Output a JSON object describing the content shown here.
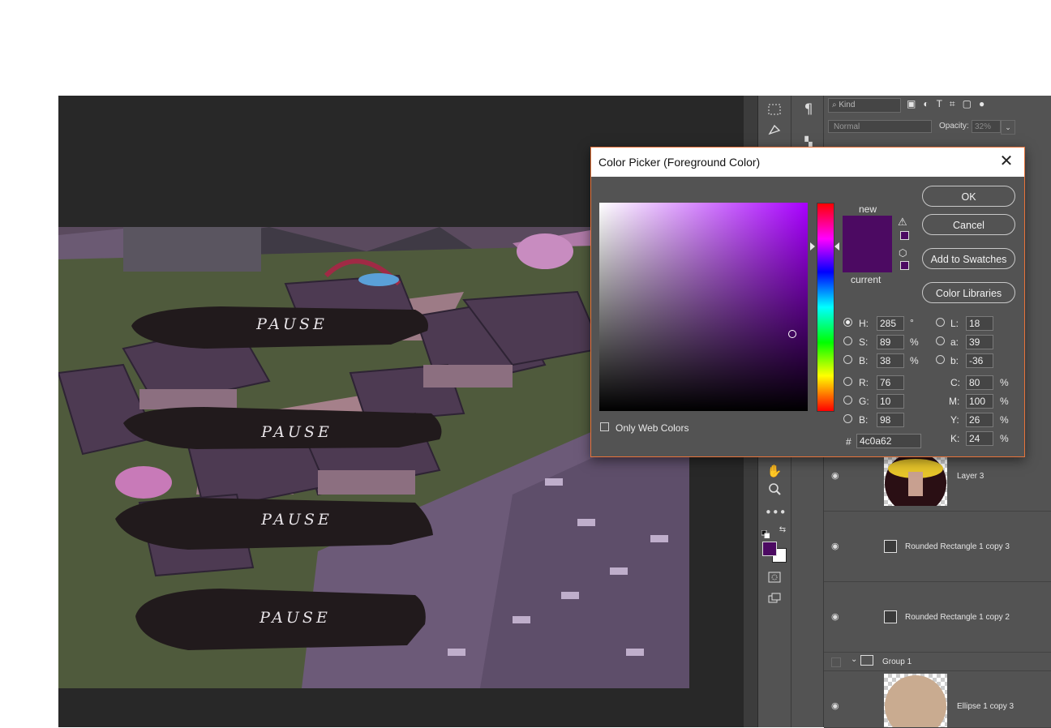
{
  "scene": {
    "pause_buttons": [
      "PAUSE",
      "PAUSE",
      "PAUSE",
      "PAUSE"
    ]
  },
  "layers_panel": {
    "filter_kind": "Kind",
    "blend_mode": "Normal",
    "opacity_label": "Opacity:",
    "opacity_value": "32%",
    "layers": [
      {
        "name": "Layer 3"
      },
      {
        "name": "Rounded Rectangle 1 copy 3"
      },
      {
        "name": "Rounded Rectangle 1 copy 2"
      },
      {
        "name": "Group 1"
      },
      {
        "name": "Ellipse 1 copy 3"
      }
    ]
  },
  "color_picker": {
    "title": "Color Picker (Foreground Color)",
    "new_label": "new",
    "current_label": "current",
    "new_color": "#4c0a62",
    "current_color": "#4c0a62",
    "buttons": {
      "ok": "OK",
      "cancel": "Cancel",
      "add_to_swatches": "Add to Swatches",
      "color_libraries": "Color Libraries"
    },
    "only_web_colors": "Only Web Colors",
    "hsb": {
      "h_label": "H:",
      "h": "285",
      "h_unit": "°",
      "s_label": "S:",
      "s": "89",
      "s_unit": "%",
      "b_label": "B:",
      "b": "38",
      "b_unit": "%"
    },
    "rgb": {
      "r_label": "R:",
      "r": "76",
      "g_label": "G:",
      "g": "10",
      "b_label": "B:",
      "b": "98"
    },
    "lab": {
      "l_label": "L:",
      "l": "18",
      "a_label": "a:",
      "a": "39",
      "b_label": "b:",
      "b": "-36"
    },
    "cmyk": {
      "c_label": "C:",
      "c": "80",
      "m_label": "M:",
      "m": "100",
      "y_label": "Y:",
      "y": "26",
      "k_label": "K:",
      "k": "24",
      "unit": "%"
    },
    "hex_label": "#",
    "hex": "4c0a62"
  },
  "colors": {
    "accent_border": "#e8743b",
    "foreground": "#4c0a62",
    "panel": "#535353"
  }
}
